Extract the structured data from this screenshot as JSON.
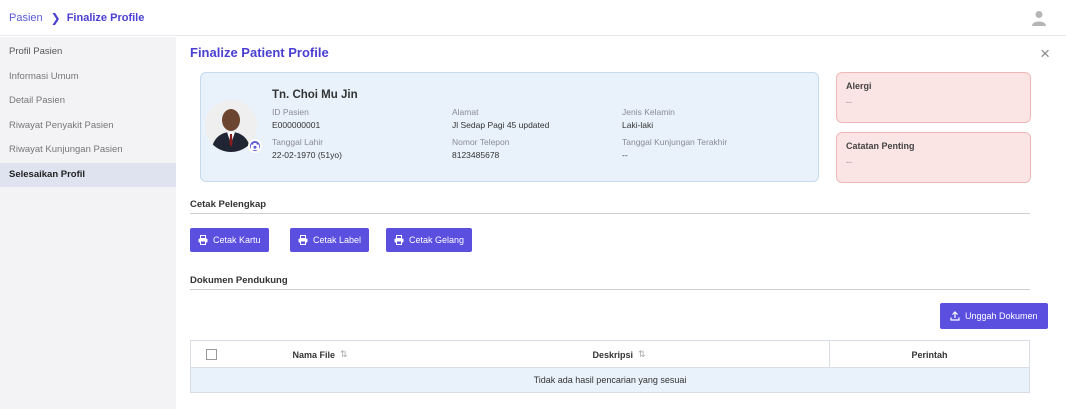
{
  "breadcrumb": {
    "parent": "Pasien",
    "current": "Finalize Profile"
  },
  "sidebar": {
    "items": [
      {
        "label": "Profil Pasien"
      },
      {
        "label": "Informasi Umum"
      },
      {
        "label": "Detail Pasien"
      },
      {
        "label": "Riwayat Penyakit Pasien"
      },
      {
        "label": "Riwayat Kunjungan Pasien"
      },
      {
        "label": "Selesaikan Profil"
      }
    ]
  },
  "page": {
    "title": "Finalize Patient Profile",
    "close": "×"
  },
  "patient": {
    "name": "Tn. Choi Mu Jin",
    "id_label": "ID Pasien",
    "id_value": "E000000001",
    "dob_label": "Tanggal Lahir",
    "dob_value": "22-02-1970 (51yo)",
    "address_label": "Alamat",
    "address_value": "Jl Sedap Pagi 45 updated",
    "phone_label": "Nomor Telepon",
    "phone_value": "8123485678",
    "gender_label": "Jenis Kelamin",
    "gender_value": "Laki-laki",
    "last_visit_label": "Tanggal Kunjungan Terakhir",
    "last_visit_value": "--"
  },
  "alergi": {
    "title": "Alergi",
    "value": "--"
  },
  "catatan": {
    "title": "Catatan Penting",
    "value": "--"
  },
  "print_section": {
    "title": "Cetak Pelengkap",
    "buttons": [
      "Cetak Kartu",
      "Cetak Label",
      "Cetak Gelang"
    ]
  },
  "docs_section": {
    "title": "Dokumen Pendukung",
    "upload_label": "Unggah Dokumen",
    "columns": [
      "Nama File",
      "Deskripsi",
      "Perintah"
    ],
    "empty_text": "Tidak ada hasil pencarian yang sesuai"
  },
  "colors": {
    "primary": "#5b4fe0",
    "card_bg": "#e9f2fb",
    "alert_bg": "#fbe4e4"
  },
  "icons": {
    "breadcrumb_sep": "chevron-right-icon",
    "user": "user-icon",
    "camera": "camera-icon",
    "print": "print-icon",
    "upload": "upload-icon",
    "sort": "sort-icon"
  }
}
